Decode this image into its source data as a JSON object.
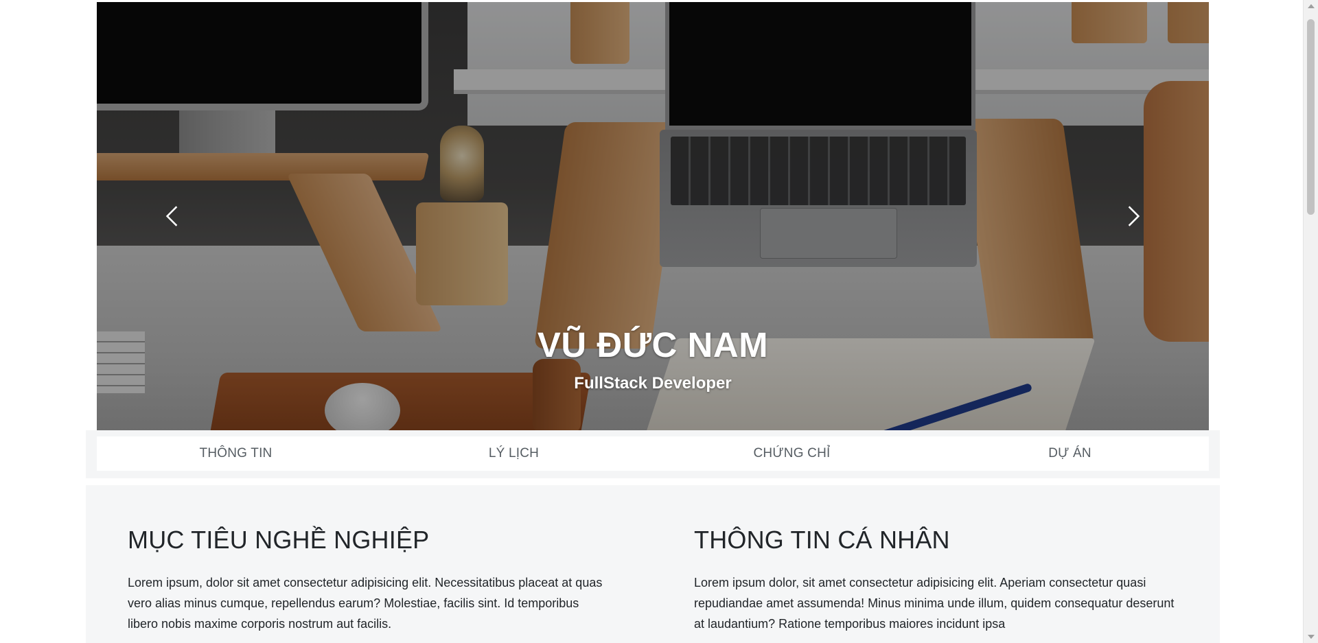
{
  "hero": {
    "name": "VŨ ĐỨC NAM",
    "role": "FullStack Developer",
    "prev_icon": "chevron-left-icon",
    "next_icon": "chevron-right-icon"
  },
  "nav": {
    "items": [
      {
        "label": "THÔNG TIN"
      },
      {
        "label": "LÝ LỊCH"
      },
      {
        "label": "CHỨNG CHỈ"
      },
      {
        "label": "DỰ ÁN"
      }
    ]
  },
  "sections": {
    "career_goal": {
      "title": "MỤC TIÊU NGHỀ NGHIỆP",
      "text": "Lorem ipsum, dolor sit amet consectetur adipisicing elit. Necessitatibus placeat at quas vero alias minus cumque, repellendus earum? Molestiae, facilis sint. Id temporibus libero nobis maxime corporis nostrum aut facilis."
    },
    "personal_info": {
      "title": "THÔNG TIN CÁ NHÂN",
      "text": "Lorem ipsum dolor, sit amet consectetur adipisicing elit. Aperiam consectetur quasi repudiandae amet assumenda! Minus minima unde illum, quidem consequatur deserunt at laudantium? Ratione temporibus maiores incidunt ipsa"
    }
  },
  "colors": {
    "nav_text": "#555c62",
    "content_bg": "#f5f6f7",
    "heading": "#212529"
  }
}
